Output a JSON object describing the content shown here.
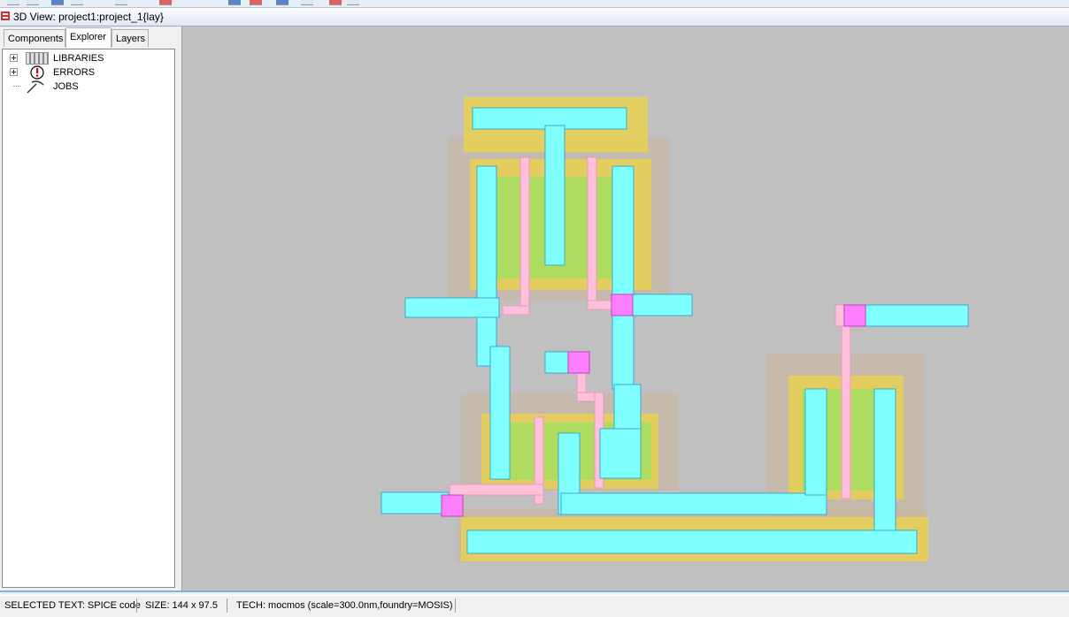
{
  "window": {
    "title": "3D View: project1:project_1{lay}"
  },
  "tabs": [
    {
      "label": "Components",
      "active": false
    },
    {
      "label": "Explorer",
      "active": true
    },
    {
      "label": "Layers",
      "active": false
    }
  ],
  "tree": [
    {
      "label": "LIBRARIES",
      "icon": "library-icon",
      "expandable": true
    },
    {
      "label": "ERRORS",
      "icon": "error-icon",
      "expandable": true
    },
    {
      "label": "JOBS",
      "icon": "jobs-icon",
      "expandable": false
    }
  ],
  "status": {
    "selected": "SELECTED TEXT: SPICE code",
    "size": "SIZE: 144 x 97.5",
    "tech": "TECH: mocmos (scale=300.0nm,foundry=MOSIS)"
  },
  "colors": {
    "canvas_bg": "#c0c0c0",
    "metal1": "#80ffff",
    "polysilicon": "#ffc0dc",
    "contact": "#ff80ff",
    "well": "#c8b49a",
    "select": "#e8d050",
    "active": "#a0e060",
    "status_border": "#74b6e0"
  }
}
